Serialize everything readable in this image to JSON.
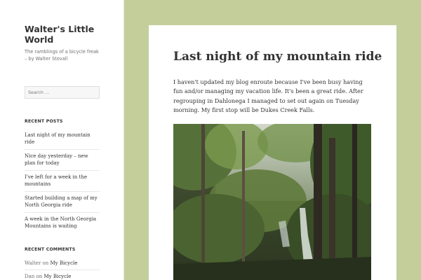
{
  "site": {
    "title": "Walter's Little World",
    "description": "The ramblings of a bicycle freak – by Walter Stovall"
  },
  "search": {
    "placeholder": "Search …"
  },
  "recent_posts": {
    "title": "RECENT POSTS",
    "items": [
      "Last night of my mountain ride",
      "Nice day yesterday – new plan for today",
      "I've left for a week in the mountains",
      "Started building a map of my North Georgia ride",
      "A week in the North Georgia Mountains is waiting"
    ]
  },
  "recent_comments": {
    "title": "RECENT COMMENTS",
    "on_word": "on",
    "items": [
      {
        "author": "Walter",
        "post": "My Bicycle"
      },
      {
        "author": "Dan",
        "post": "My Bicycle"
      }
    ]
  },
  "post": {
    "title": "Last night of my mountain ride",
    "body": "I haven't updated my blog enroute because I've been busy having fun and/or managing my vacation life. It's been a great ride. After regrouping in Dahlonega I managed to set out again on Tuesday morning. My first stop will be Dukes Creek Falls."
  },
  "colors": {
    "page_background": "#c3ce9a",
    "panel_background": "#ffffff",
    "text": "#333333",
    "muted_text": "#707070"
  }
}
